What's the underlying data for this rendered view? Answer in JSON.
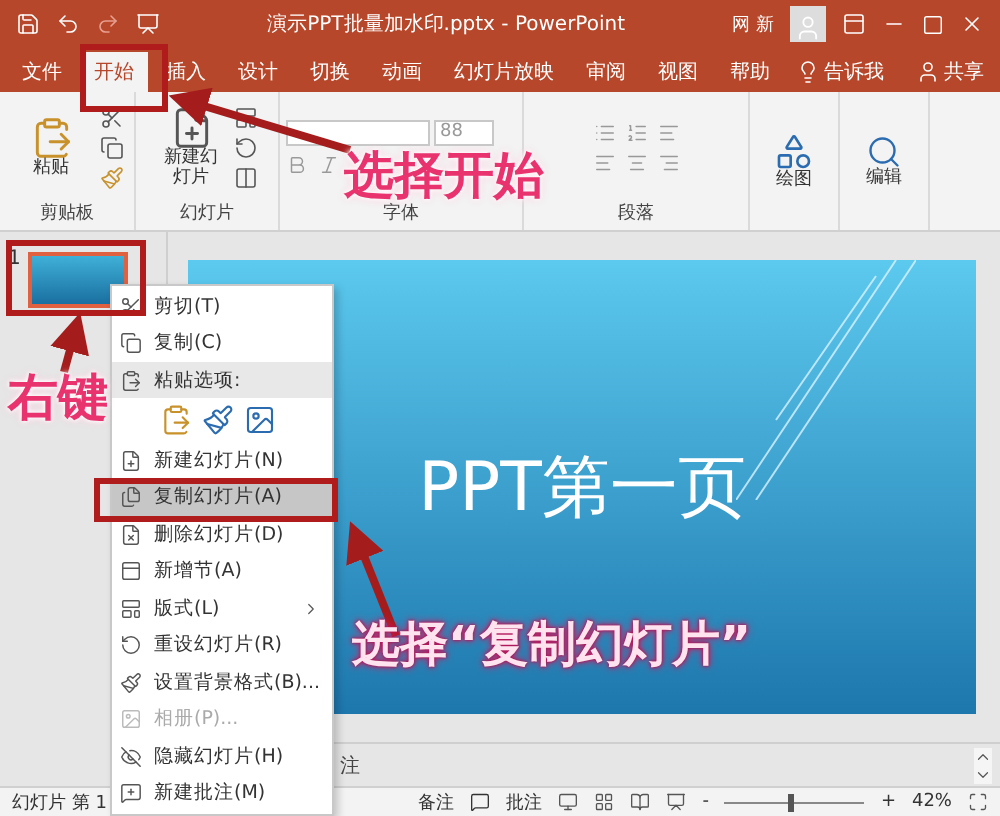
{
  "title_bar": {
    "title": "演示PPT批量加水印.pptx  -  PowerPoint",
    "user": "网 新"
  },
  "tabs": [
    {
      "label": "文件",
      "selected": false
    },
    {
      "label": "开始",
      "selected": true
    },
    {
      "label": "插入",
      "selected": false
    },
    {
      "label": "设计",
      "selected": false
    },
    {
      "label": "切换",
      "selected": false
    },
    {
      "label": "动画",
      "selected": false
    },
    {
      "label": "幻灯片放映",
      "selected": false
    },
    {
      "label": "审阅",
      "selected": false
    },
    {
      "label": "视图",
      "selected": false
    },
    {
      "label": "帮助",
      "selected": false
    }
  ],
  "tell_me": "告诉我",
  "share": "共享",
  "ribbon": {
    "groups": [
      {
        "label": "剪贴板",
        "kind": "clipboard",
        "button": "粘贴"
      },
      {
        "label": "幻灯片",
        "kind": "slides",
        "button": "新建幻灯片"
      },
      {
        "label": "字体",
        "kind": "font",
        "font_size": "88"
      },
      {
        "label": "段落",
        "kind": "paragraph"
      },
      {
        "kind": "drawing",
        "button": "绘图"
      },
      {
        "kind": "editing",
        "button": "编辑"
      }
    ]
  },
  "thumbnails": [
    {
      "number": "1",
      "selected": true
    }
  ],
  "slide": {
    "title": "PPT第一页"
  },
  "context_menu": [
    {
      "kind": "item",
      "label": "剪切(T)",
      "disabled": false,
      "selected": false
    },
    {
      "kind": "item",
      "label": "复制(C)",
      "disabled": false,
      "selected": false
    },
    {
      "kind": "header",
      "label": "粘贴选项:"
    },
    {
      "kind": "paste_options"
    },
    {
      "kind": "item",
      "label": "新建幻灯片(N)",
      "disabled": false,
      "selected": false
    },
    {
      "kind": "item",
      "label": "复制幻灯片(A)",
      "disabled": false,
      "selected": true
    },
    {
      "kind": "item",
      "label": "删除幻灯片(D)",
      "disabled": false,
      "selected": false
    },
    {
      "kind": "item",
      "label": "新增节(A)",
      "disabled": false,
      "selected": false
    },
    {
      "kind": "submenu",
      "label": "版式(L)",
      "disabled": false,
      "selected": false
    },
    {
      "kind": "item",
      "label": "重设幻灯片(R)",
      "disabled": false,
      "selected": false
    },
    {
      "kind": "item",
      "label": "设置背景格式(B)...",
      "disabled": false,
      "selected": false
    },
    {
      "kind": "item",
      "label": "相册(P)...",
      "disabled": true,
      "selected": false
    },
    {
      "kind": "item",
      "label": "隐藏幻灯片(H)",
      "disabled": false,
      "selected": false
    },
    {
      "kind": "item",
      "label": "新建批注(M)",
      "disabled": false,
      "selected": false
    }
  ],
  "notes_text": "注",
  "status_bar": {
    "slide_info": "幻灯片 第 1",
    "notes": "备注",
    "comments": "批注",
    "zoom_out": "-",
    "zoom_slider": {
      "level": 0.45
    },
    "zoom_in": "+",
    "zoom": "42%"
  },
  "annotations": [
    {
      "text": "选择开始"
    },
    {
      "text": "右键"
    },
    {
      "text": "选择“复制幻灯片”"
    }
  ]
}
